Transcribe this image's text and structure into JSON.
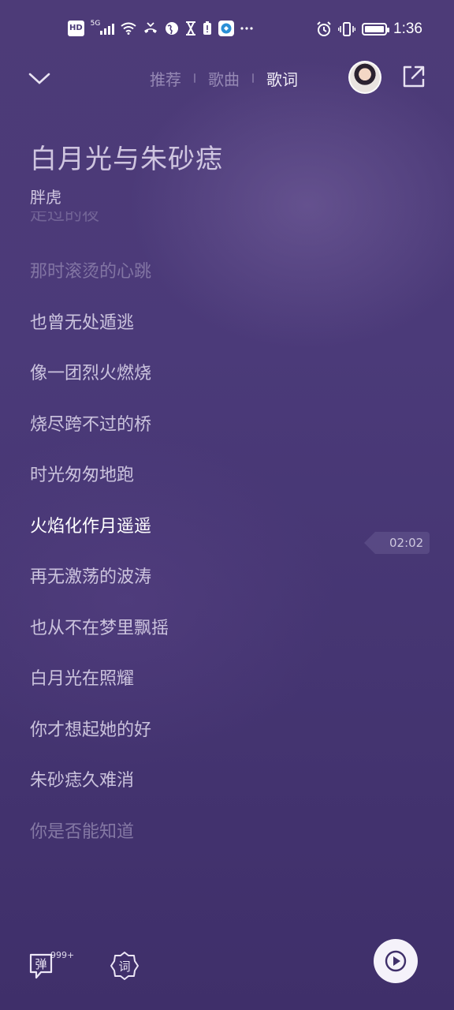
{
  "status_bar": {
    "hd": "HD",
    "network": "5G",
    "time": "1:36",
    "battery_level": 0.9
  },
  "header": {
    "tabs": [
      {
        "label": "推荐",
        "active": false
      },
      {
        "label": "歌曲",
        "active": false
      },
      {
        "label": "歌词",
        "active": true
      }
    ]
  },
  "song": {
    "title": "白月光与朱砂痣",
    "artist": "胖虎"
  },
  "lyrics": {
    "partial_top": "走过的夜",
    "lines": [
      "那时滚烫的心跳",
      "也曾无处遁逃",
      "像一团烈火燃烧",
      "烧尽跨不过的桥",
      "时光匆匆地跑",
      "火焰化作月遥遥",
      "再无激荡的波涛",
      "也从不在梦里飘摇",
      "白月光在照耀",
      "你才想起她的好",
      "朱砂痣久难消",
      "你是否能知道"
    ],
    "current_index": 5,
    "current_time": "02:02"
  },
  "bottom_bar": {
    "danmaku_label": "弹",
    "danmaku_count": "999+",
    "lyric_style_label": "词"
  },
  "colors": {
    "background": "#4b3a79",
    "text": "#e8e2f2"
  }
}
